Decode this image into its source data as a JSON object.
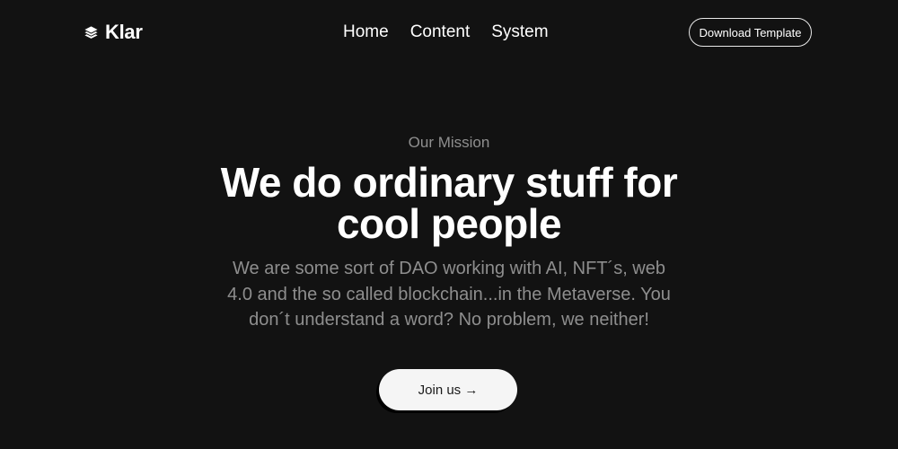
{
  "brand": {
    "name": "Klar",
    "icon": "layers-icon"
  },
  "nav": {
    "links": [
      "Home",
      "Content",
      "System"
    ],
    "download_label": "Download Template"
  },
  "hero": {
    "eyebrow": "Our Mission",
    "headline": "We do ordinary stuff for cool people",
    "description": "We are some sort of DAO working with AI, NFT´s, web 4.0 and the so called blockchain...in the Metaverse. You don´t understand a word? No problem, we neither!",
    "cta_label": "Join us →"
  },
  "colors": {
    "background": "#121212",
    "text": "#ffffff",
    "muted_text": "#8e8e8e",
    "button_fill": "#f5f5f5"
  }
}
